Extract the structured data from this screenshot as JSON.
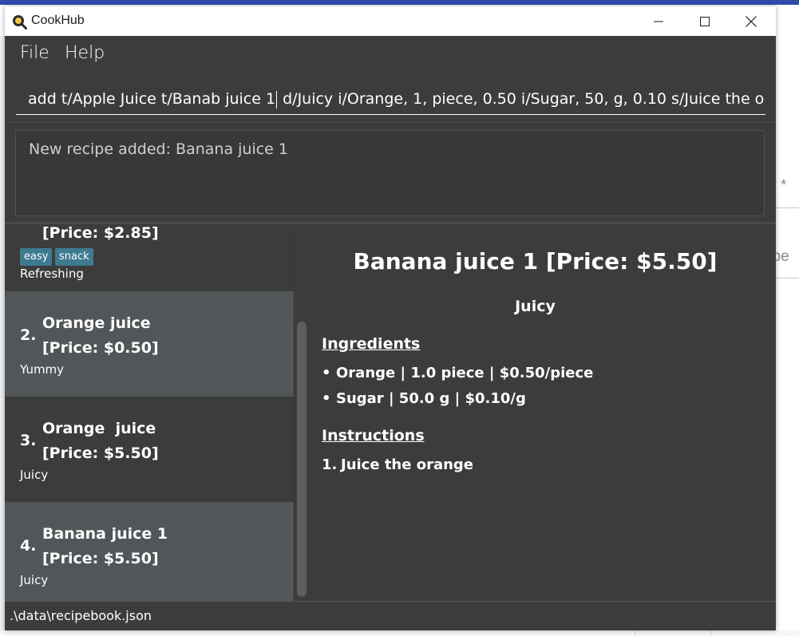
{
  "window": {
    "title": "CookHub"
  },
  "menu": {
    "file": "File",
    "help": "Help"
  },
  "command": {
    "before_caret": "add t/Apple Juice t/Banab juice 1",
    "after_caret": " d/Juicy i/Orange, 1, piece, 0.50 i/Sugar, 50, g, 0.10 s/Juice the orang"
  },
  "result": {
    "message": "New recipe added: Banana juice 1"
  },
  "recipe_list": [
    {
      "index": "",
      "name": "",
      "price": "[Price: $2.85]",
      "tags": [
        "easy",
        "snack"
      ],
      "description": "Refreshing"
    },
    {
      "index": "2.",
      "name": "Orange juice",
      "price": "[Price: $0.50]",
      "tags": [],
      "description": "Yummy"
    },
    {
      "index": "3.",
      "name": "Orange  juice",
      "price": "[Price: $5.50]",
      "tags": [],
      "description": "Juicy"
    },
    {
      "index": "4.",
      "name": "Banana juice 1",
      "price": "[Price: $5.50]",
      "tags": [],
      "description": "Juicy"
    }
  ],
  "detail": {
    "title": "Banana juice 1 [Price: $5.50]",
    "description": "Juicy",
    "ingredients_heading": "Ingredients",
    "ingredients": [
      "Orange | 1.0 piece | $0.50/piece",
      "Sugar | 50.0 g | $0.10/g"
    ],
    "instructions_heading": "Instructions",
    "instructions": [
      {
        "num": "1.",
        "text": "Juice the orange"
      }
    ]
  },
  "status": {
    "path": ".\\data\\recipebook.json"
  },
  "background": {
    "fragment_1": "ty *",
    "fragment_2": "ype"
  },
  "colors": {
    "window_bg": "#3c3c3c",
    "selected_card": "#515659",
    "tag_bg": "#3e7b91",
    "title_bar": "#ffffff"
  },
  "icons": {
    "app": "cookhub-logo-icon",
    "minimize": "minimize-icon",
    "maximize": "maximize-icon",
    "close": "close-icon"
  }
}
